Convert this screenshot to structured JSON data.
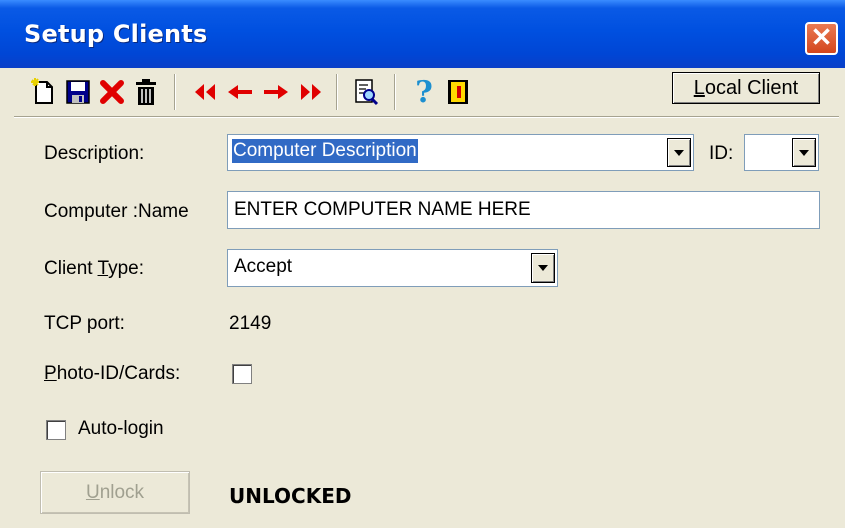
{
  "window": {
    "title": "Setup Clients"
  },
  "toolbar": {
    "buttons": [
      "new-icon",
      "save-icon",
      "delete-x-icon",
      "trash-icon",
      "first-record-icon",
      "prev-record-icon",
      "next-record-icon",
      "last-record-icon",
      "search-icon",
      "help-icon",
      "exit-door-icon"
    ],
    "local_client_label": "Local Client"
  },
  "form": {
    "description_label": "Description:",
    "description_value": "Computer Description",
    "id_label": "ID:",
    "id_value": "",
    "computer_name_label": "Computer :Name",
    "computer_name_value": "ENTER COMPUTER NAME HERE",
    "client_type_label_pre": "Client ",
    "client_type_label_u": "T",
    "client_type_label_post": "ype:",
    "client_type_value": "Accept",
    "tcp_port_label": "TCP port:",
    "tcp_port_value": "2149",
    "photo_id_label_u": "P",
    "photo_id_label_post": "hoto-ID/Cards:",
    "photo_id_checked": false,
    "auto_login_label": "Auto-login",
    "auto_login_checked": false
  },
  "footer": {
    "unlock_label_u": "U",
    "unlock_label_post": "nlock",
    "status_text": "UNLOCKED"
  },
  "colors": {
    "title_bar": "#0050e0",
    "selection": "#316ac5",
    "close_button": "#d4461e",
    "nav_arrows": "#e00000"
  }
}
